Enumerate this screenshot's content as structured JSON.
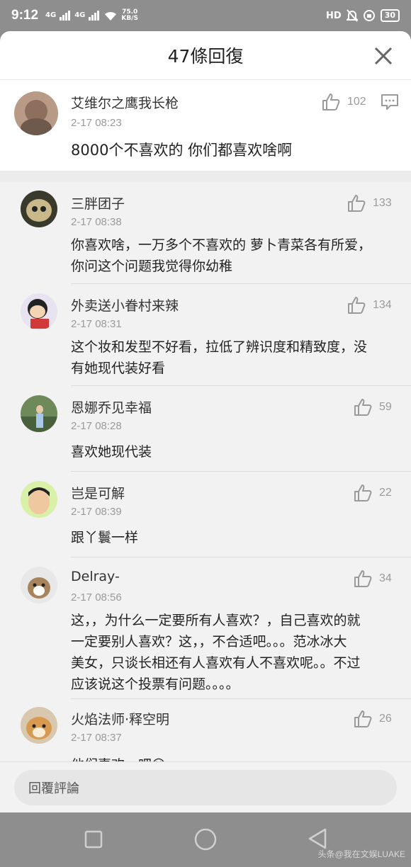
{
  "status_bar": {
    "time": "9:12",
    "signal1": "4G",
    "signal2": "4G",
    "net_speed_value": "75.0",
    "net_speed_unit": "KB/S",
    "hd_label": "HD",
    "battery": "30"
  },
  "sheet": {
    "title": "47條回復"
  },
  "top_comment": {
    "name": "艾维尔之鹰我长枪",
    "time": "2-17 08:23",
    "likes": "102",
    "text": "8000个不喜欢的 你们都喜欢啥啊"
  },
  "replies": [
    {
      "name": "三胖团子",
      "time": "2-17 08:38",
      "likes": "133",
      "lines": [
        "你喜欢啥，一万多个不喜欢的 萝卜青菜各有所爱，",
        "你问这个问题我觉得你幼稚"
      ]
    },
    {
      "name": "外卖送小眷村来辣",
      "time": "2-17 08:31",
      "likes": "134",
      "lines": [
        "这个妆和发型不好看，拉低了辨识度和精致度，没",
        "有她现代装好看"
      ]
    },
    {
      "name": "恩娜乔见幸福",
      "time": "2-17 08:28",
      "likes": "59",
      "lines": [
        "喜欢她现代装"
      ]
    },
    {
      "name": "岂是可解",
      "time": "2-17 08:39",
      "likes": "22",
      "lines": [
        "跟丫鬟一样"
      ]
    },
    {
      "name": "Delray-",
      "time": "2-17 08:56",
      "likes": "34",
      "lines": [
        "这，，为什么一定要所有人喜欢？，自己喜欢的就",
        "一定要别人喜欢？这，，不合适吧。。。范冰冰大",
        "美女，只谈长相还有人喜欢有人不喜欢呢。。不过",
        "应该说这个投票有问题。。。。"
      ]
    },
    {
      "name": "火焰法师·释空明",
      "time": "2-17 08:37",
      "likes": "26",
      "lines": [
        "他们喜欢一吧😊"
      ]
    }
  ],
  "input": {
    "placeholder": "回覆評論"
  },
  "watermark": "头条@我在文娱LUAKE",
  "colors": {
    "status_bar": "#8e8e8e",
    "reply_bg": "#f2f2f2",
    "muted_text": "#9a9a9a"
  },
  "icons": {
    "close": "close-icon",
    "like": "thumbs-up-icon",
    "message": "comment-icon",
    "nav_recent": "square-icon",
    "nav_home": "circle-icon",
    "nav_back": "triangle-back-icon"
  }
}
